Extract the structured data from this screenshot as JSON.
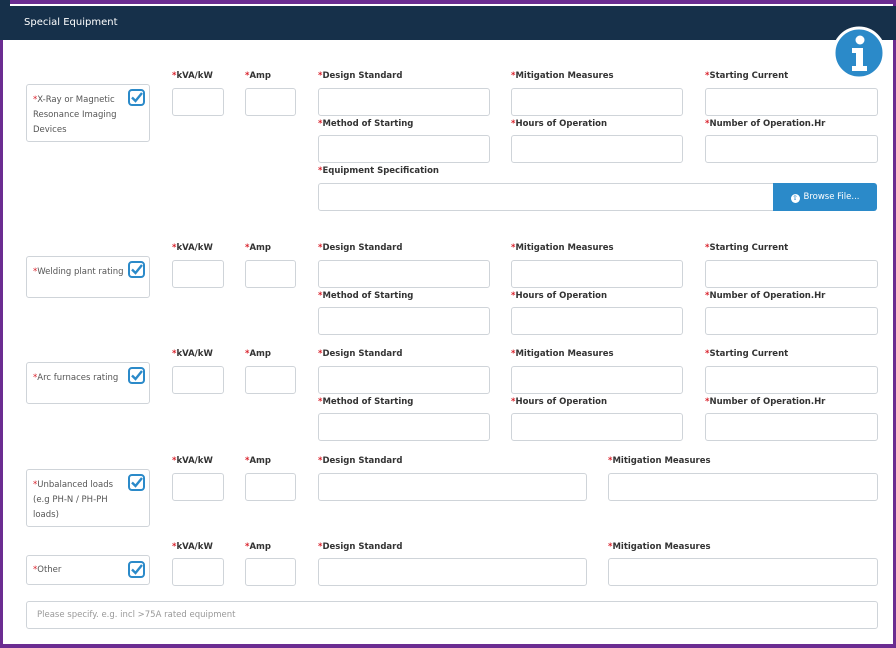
{
  "panel_title": "Special Equipment",
  "required_marker": "*",
  "colors": {
    "header": "#16304a",
    "frame": "#6b2c91",
    "required": "#d9232d",
    "check": "#2b8ac9"
  },
  "labels": {
    "kva": "kVA/kW",
    "amp": "Amp",
    "design_standard": "Design Standard",
    "mitigation_measures": "Mitigation Measures",
    "starting_current": "Starting Current",
    "method_of_starting": "Method of Starting",
    "hours_of_operation": "Hours of Operation",
    "number_of_operation": "Number of Operation.Hr",
    "equipment_specification": "Equipment Specification"
  },
  "equipment": [
    {
      "label": "X-Ray or Magnetic Resonance Imaging Devices",
      "checked": true
    },
    {
      "label": "Welding plant rating",
      "checked": true
    },
    {
      "label": "Arc furnaces rating",
      "checked": true
    },
    {
      "label": "Unbalanced loads (e.g PH-N / PH-PH loads)",
      "checked": true
    },
    {
      "label": "Other",
      "checked": true
    }
  ],
  "browse_button": "Browse File...",
  "specify_placeholder": "Please specify. e.g. incl >75A rated equipment",
  "icons": {
    "info": "info-icon",
    "checkbox": "checkbox-checked-icon",
    "upload": "upload-circle-icon"
  }
}
